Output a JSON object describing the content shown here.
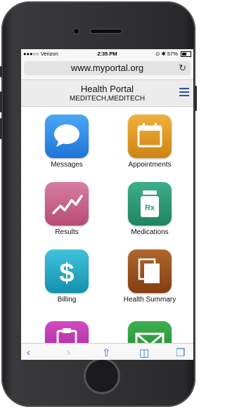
{
  "status_bar": {
    "carrier": "●●●○○ Verizon",
    "time": "2:35 PM",
    "battery": "57%",
    "status_icons": "⊙ ✱"
  },
  "browser": {
    "url": "www.myportal.org",
    "reload_icon": "↻",
    "toolbar_icons": [
      "back-icon",
      "forward-icon",
      "share-icon",
      "bookmarks-icon",
      "tabs-icon"
    ]
  },
  "header": {
    "title": "Health Portal",
    "subtitle": "MEDITECH,MEDITECH"
  },
  "tiles": [
    {
      "label": "Messages",
      "icon": "speech-bubble-icon",
      "color": "#2f8fe8"
    },
    {
      "label": "Appointments",
      "icon": "calendar-icon",
      "color": "#e09820"
    },
    {
      "label": "Results",
      "icon": "chart-line-icon",
      "color": "#c9648a"
    },
    {
      "label": "Medications",
      "icon": "pill-bottle-icon",
      "color": "#2f9a78"
    },
    {
      "label": "Billing",
      "icon": "dollar-icon",
      "color": "#20a8c4"
    },
    {
      "label": "Health Summary",
      "icon": "documents-icon",
      "color": "#9a5220"
    },
    {
      "label": "",
      "icon": "clipboard-icon",
      "color": "#c030b0"
    },
    {
      "label": "",
      "icon": "envelope-icon",
      "color": "#2e9a40"
    }
  ]
}
